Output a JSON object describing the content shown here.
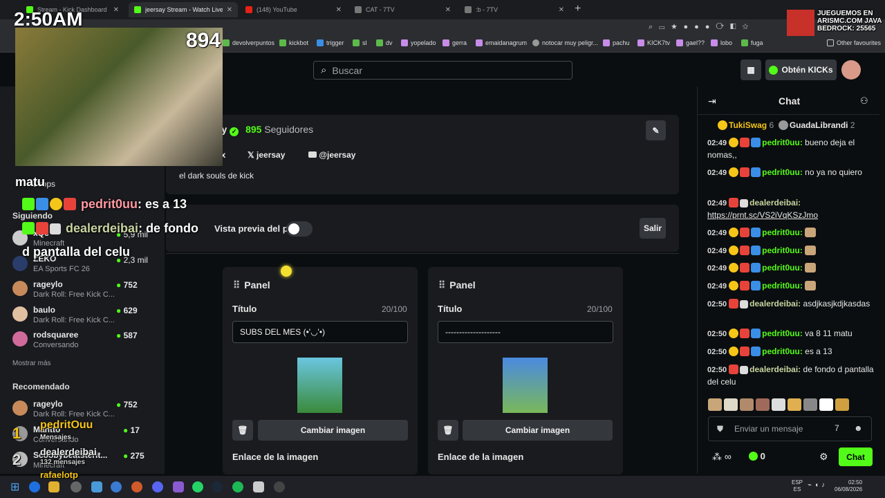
{
  "browser": {
    "tabs": [
      {
        "label": "Stream - Kick Dashboard",
        "active": false
      },
      {
        "label": "jeersay Stream - Watch Live on Kick",
        "active": true
      },
      {
        "label": "(148) YouTube",
        "active": false
      },
      {
        "label": "CAT - 7TV",
        "active": false
      },
      {
        "label": ":b - 7TV",
        "active": false
      }
    ],
    "bookmarks": [
      "devolverpuntos",
      "kickbot",
      "trigger",
      "sl",
      "dv",
      "yopelado",
      "gerra",
      "emaidanagrum",
      "notocar muy peligr...",
      "pachu",
      "KICK7tv",
      "gael??",
      "lobo",
      "fuga",
      "Other favourites"
    ]
  },
  "overlay": {
    "clock": "2:50AM",
    "viewers": "894",
    "server_banner_line1": "JUEGUEMOS EN",
    "server_banner_line2": "ARISMC.COM JAVA",
    "server_banner_line3": "BEDROCK: 25565",
    "chat_lines": [
      {
        "user": "matu",
        "text": ""
      },
      {
        "user": "pedrit0uu",
        "text": "es a 13"
      },
      {
        "user": "dealerdeibai",
        "text": "de fondo"
      },
      {
        "user": "",
        "text": "d pantalla del celu"
      }
    ],
    "alert_user_1": "pedritOuu",
    "alert_sub_1": "Mensajes",
    "alert_user_2": "dealerdeibai",
    "alert_sub_2": "132 mensajes",
    "alert_user_3": "rafaelotp",
    "alert_rank_1": "1",
    "alert_rank_2": "2"
  },
  "header": {
    "search_placeholder": "Buscar",
    "get_kicks_label": "Obtén KICKs"
  },
  "sidebar": {
    "drops_label": "Drops",
    "following_title": "Siguiendo",
    "following": [
      {
        "name": "xQc",
        "category": "Minecraft",
        "viewers": "5,9 mil"
      },
      {
        "name": "ZEKO",
        "category": "EA Sports FC 26",
        "viewers": "2,3 mil"
      },
      {
        "name": "rageylo",
        "category": "Dark Roll: Free Kick C...",
        "viewers": "752"
      },
      {
        "name": "baulo",
        "category": "Dark Roll: Free Kick C...",
        "viewers": "629"
      },
      {
        "name": "rodsquaree",
        "category": "Conversando",
        "viewers": "587"
      }
    ],
    "show_more": "Mostrar más",
    "recommended_title": "Recomendado",
    "recommended": [
      {
        "name": "rageylo",
        "category": "Dark Roll: Free Kick C...",
        "viewers": "752"
      },
      {
        "name": "Mantto",
        "category": "Conversando",
        "viewers": "17"
      },
      {
        "name": "Scoobybeatsterit...",
        "category": "Minecraft",
        "viewers": "275"
      }
    ]
  },
  "profile": {
    "name": "jeersay",
    "followers_count": "895",
    "followers_label": "Seguidores",
    "social_1": "yx",
    "social_x": "jeersay",
    "social_youtube": "@jeersay",
    "bio": "el dark souls de kick",
    "preview_label": "Vista previa del panel",
    "exit_label": "Salir"
  },
  "panels": [
    {
      "title": "Panel",
      "field_label": "Título",
      "counter": "20/100",
      "value": "SUBS DEL MES (•'◡'•)",
      "change_label": "Cambiar imagen",
      "link_label": "Enlace de la imagen"
    },
    {
      "title": "Panel",
      "field_label": "Título",
      "counter": "20/100",
      "value": "--------------------",
      "change_label": "Cambiar imagen",
      "link_label": "Enlace de la imagen"
    }
  ],
  "chat": {
    "title": "Chat",
    "top_users": [
      {
        "name": "TukiSwag",
        "count": "6"
      },
      {
        "name": "GuadaLibrandi",
        "count": "2"
      }
    ],
    "messages": [
      {
        "time": "02:49",
        "user": "pedrit0uu",
        "text": "bueno deja el nomas,,"
      },
      {
        "time": "02:49",
        "user": "pedrit0uu",
        "text": "no ya no quiero"
      },
      {
        "time": "02:49",
        "user": "dealerdeibai",
        "text": "https://prnt.sc/VS2iVqKSzJmo"
      },
      {
        "time": "02:49",
        "user": "pedrit0uu",
        "text": ""
      },
      {
        "time": "02:49",
        "user": "pedrit0uu",
        "text": ""
      },
      {
        "time": "02:49",
        "user": "pedrit0uu",
        "text": ""
      },
      {
        "time": "02:49",
        "user": "pedrit0uu",
        "text": ""
      },
      {
        "time": "02:50",
        "user": "dealerdeibai",
        "text": "asdjkasjkdjkasdas"
      },
      {
        "time": "02:50",
        "user": "pedrit0uu",
        "text": "va 8 11 matu"
      },
      {
        "time": "02:50",
        "user": "pedrit0uu",
        "text": "es a 13"
      },
      {
        "time": "02:50",
        "user": "dealerdeibai",
        "text": "de fondo d pantalla del celu"
      }
    ],
    "input_placeholder": "Enviar un mensaje",
    "points": "∞",
    "kicks_count": "0",
    "send_label": "Chat"
  },
  "taskbar": {
    "lang_1": "ESP",
    "lang_2": "ES",
    "time": "02:50",
    "date": "06/08/2026"
  },
  "colors": {
    "accent": "#53fc18",
    "background": "#0b0e10",
    "card": "#191b1f"
  }
}
